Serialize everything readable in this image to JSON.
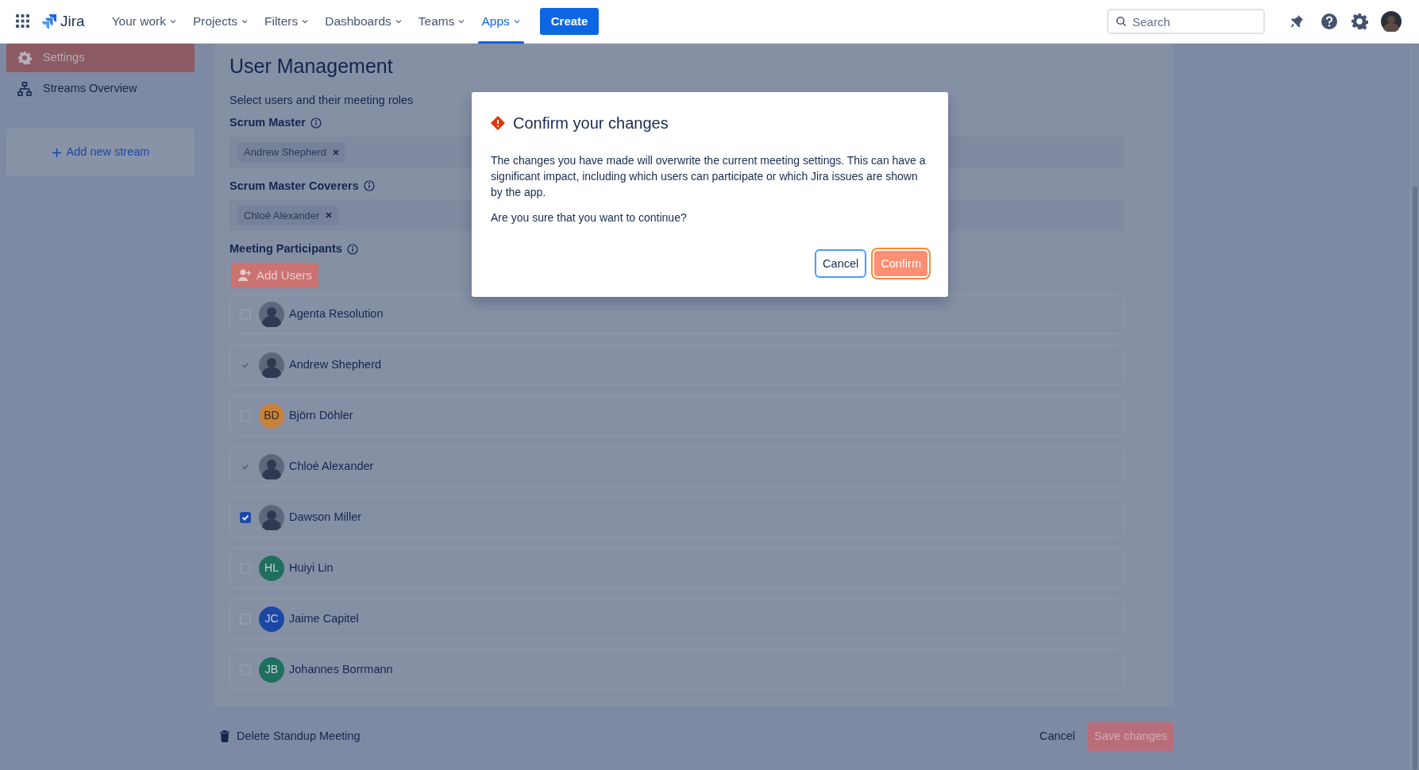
{
  "top_nav": {
    "product": "Jira",
    "items": [
      {
        "label": "Your work",
        "selected": false
      },
      {
        "label": "Projects",
        "selected": false
      },
      {
        "label": "Filters",
        "selected": false
      },
      {
        "label": "Dashboards",
        "selected": false
      },
      {
        "label": "Teams",
        "selected": false
      },
      {
        "label": "Apps",
        "selected": true
      }
    ],
    "create_button": "Create",
    "search": {
      "placeholder": "Search"
    }
  },
  "sidebar": {
    "items": [
      {
        "label": "Settings",
        "selected": true
      },
      {
        "label": "Streams Overview",
        "selected": false
      }
    ],
    "add_button": "Add new stream"
  },
  "main": {
    "title": "User Management",
    "subtitle": "Select users and their meeting roles",
    "sections": [
      {
        "label": "Scrum Master",
        "tags": [
          "Andrew Shepherd"
        ]
      },
      {
        "label": "Scrum Master Coverers",
        "tags": [
          "Chloé Alexander"
        ]
      }
    ],
    "participants": {
      "label": "Meeting Participants",
      "add_button": "Add Users",
      "users": [
        {
          "name": "Agenta Resolution",
          "checked": false,
          "disabled": false,
          "avatar": {
            "kind": "photo"
          }
        },
        {
          "name": "Andrew Shepherd",
          "checked": true,
          "disabled": true,
          "avatar": {
            "kind": "photo"
          }
        },
        {
          "name": "Björn Döhler",
          "checked": false,
          "disabled": false,
          "avatar": {
            "kind": "initials",
            "initials": "BD",
            "color": "#c6813e"
          }
        },
        {
          "name": "Chloé Alexander",
          "checked": true,
          "disabled": true,
          "avatar": {
            "kind": "photo"
          }
        },
        {
          "name": "Dawson Miller",
          "checked": true,
          "disabled": false,
          "avatar": {
            "kind": "photo"
          }
        },
        {
          "name": "Huiyi Lin",
          "checked": false,
          "disabled": false,
          "avatar": {
            "kind": "initials",
            "initials": "HL",
            "color": "#1f6f5e"
          }
        },
        {
          "name": "Jaime Capitel",
          "checked": false,
          "disabled": false,
          "avatar": {
            "kind": "initials",
            "initials": "JC",
            "color": "#1c47a6"
          }
        },
        {
          "name": "Johannes Borrmann",
          "checked": false,
          "disabled": false,
          "avatar": {
            "kind": "initials",
            "initials": "JB",
            "color": "#1f6f5e"
          }
        }
      ]
    }
  },
  "footer": {
    "delete": "Delete Standup Meeting",
    "cancel": "Cancel",
    "save": "Save changes"
  },
  "modal": {
    "title": "Confirm your changes",
    "paragraphs": [
      "The changes you have made will overwrite the current meeting settings. This can have a significant impact, including which users can participate or which Jira issues are shown by the app.",
      "Are you sure that you want to continue?"
    ],
    "buttons": [
      {
        "label": "Cancel",
        "kind": "secondary"
      },
      {
        "label": "Confirm",
        "kind": "primary"
      }
    ]
  }
}
